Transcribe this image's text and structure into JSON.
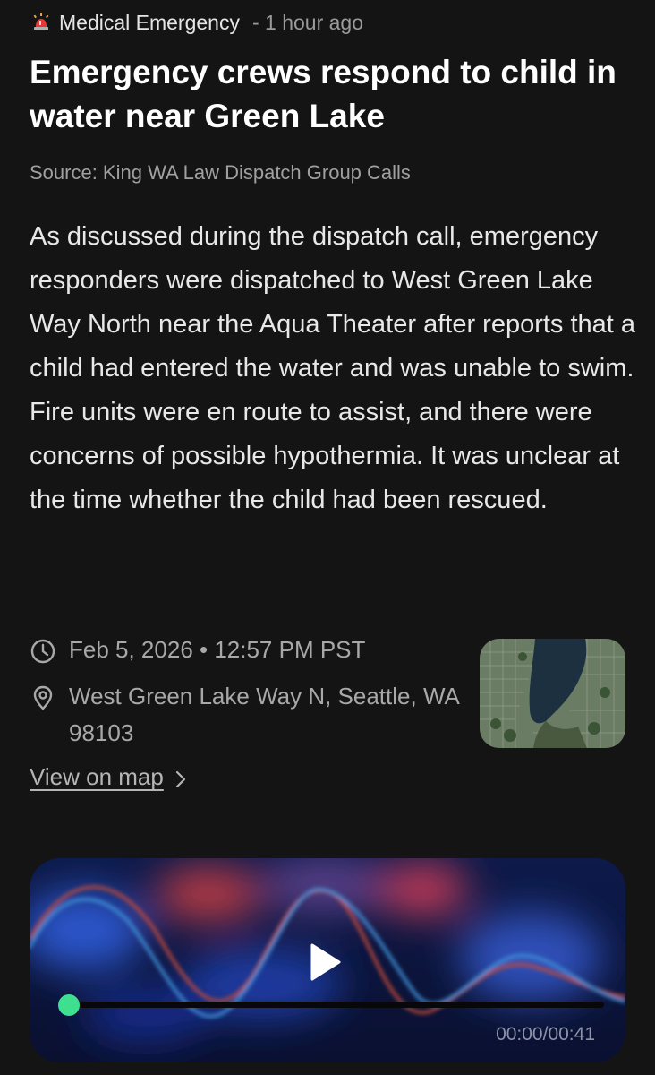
{
  "meta": {
    "category": "Medical Emergency",
    "time_ago": "- 1 hour ago"
  },
  "article": {
    "headline": "Emergency crews respond to child in water near Green Lake",
    "source": "Source: King WA Law Dispatch Group Calls",
    "body": "As discussed during the dispatch call, emergency responders were dispatched to West Green Lake Way North near the Aqua Theater after reports that a child had entered the water and was unable to swim. Fire units were en route to assist, and there were concerns of possible hypothermia. It was unclear at the time whether the child had been rescued."
  },
  "details": {
    "date_time": "Feb 5, 2026 • 12:57 PM PST",
    "location": "West Green Lake Way N, Seattle, WA 98103",
    "view_map_label": "View on map"
  },
  "audio": {
    "time_display": "00:00/00:41",
    "progress_fraction": 0
  },
  "icons": {
    "category": "siren-icon",
    "date": "clock-icon",
    "location": "location-pin-icon",
    "link": "chevron-right-icon",
    "play": "play-icon"
  },
  "colors": {
    "background": "#141414",
    "progress_knob": "#3ee08f",
    "secondary_text": "#a0a0a0"
  }
}
